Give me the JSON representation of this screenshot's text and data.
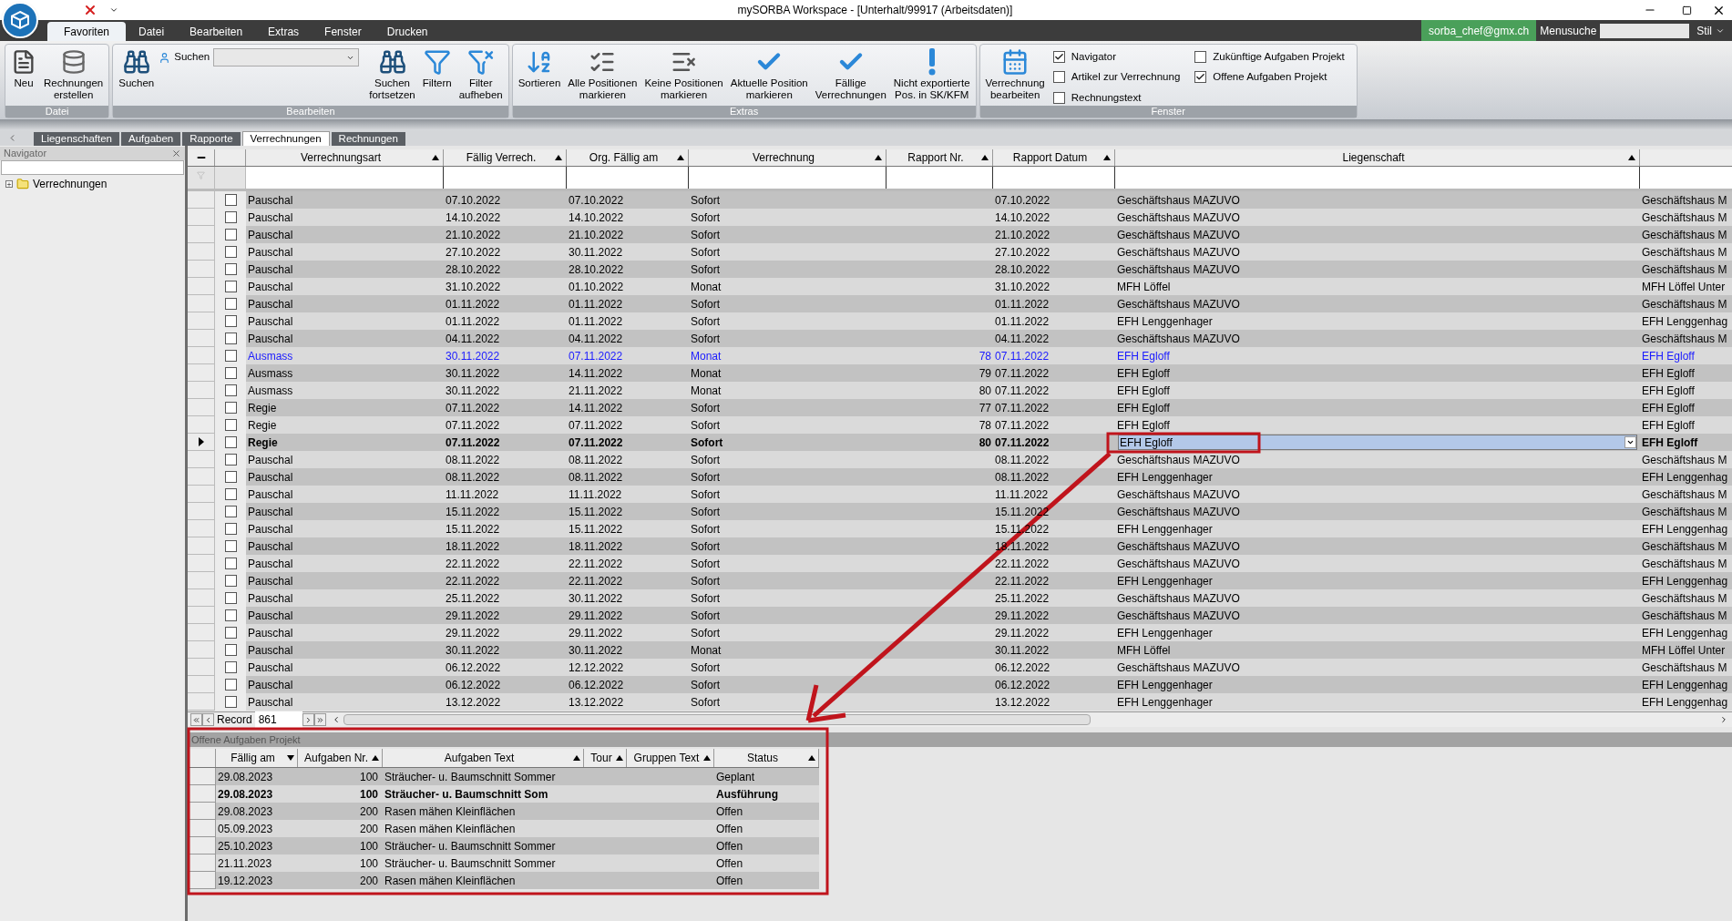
{
  "window": {
    "title": "mySORBA Workspace - [Unterhalt/99917 (Arbeitsdaten)]"
  },
  "menu_tabs": [
    {
      "label": "Favoriten",
      "selected": true
    },
    {
      "label": "Datei",
      "selected": false
    },
    {
      "label": "Bearbeiten",
      "selected": false
    },
    {
      "label": "Extras",
      "selected": false
    },
    {
      "label": "Fenster",
      "selected": false
    },
    {
      "label": "Drucken",
      "selected": false
    }
  ],
  "account": {
    "user": "sorba_chef@gmx.ch",
    "menu_search_label": "Menusuche",
    "style_label": "Stil"
  },
  "ribbon": [
    {
      "title": "Datei",
      "items": [
        {
          "kind": "button",
          "label": "Neu"
        },
        {
          "kind": "button",
          "label": "Rechnungen\nerstellen"
        }
      ]
    },
    {
      "title": "Bearbeiten",
      "items": [
        {
          "kind": "button",
          "label": "Suchen"
        },
        {
          "kind": "search",
          "label": "Suchen"
        },
        {
          "kind": "button",
          "label": "Suchen\nfortsetzen"
        },
        {
          "kind": "button",
          "label": "Filtern"
        },
        {
          "kind": "button",
          "label": "Filter\naufheben"
        }
      ]
    },
    {
      "title": "Extras",
      "items": [
        {
          "kind": "button",
          "label": "Sortieren"
        },
        {
          "kind": "button",
          "label": "Alle Positionen\nmarkieren"
        },
        {
          "kind": "button",
          "label": "Keine Positionen\nmarkieren"
        },
        {
          "kind": "button",
          "label": "Aktuelle Position\nmarkieren"
        },
        {
          "kind": "button",
          "label": "Fällige\nVerrechnungen"
        },
        {
          "kind": "button",
          "label": "Nicht exportierte\nPos. in SK/KFM"
        }
      ]
    },
    {
      "title": "Fenster",
      "items": [
        {
          "kind": "button",
          "label": "Verrechnung\nbearbeiten"
        },
        {
          "kind": "checkboxes",
          "options": [
            {
              "label": "Navigator",
              "checked": true
            },
            {
              "label": "Artikel zur Verrechnung",
              "checked": false
            },
            {
              "label": "Rechnungstext",
              "checked": false
            }
          ]
        },
        {
          "kind": "checkboxes",
          "options": [
            {
              "label": "Zukünftige Aufgaben Projekt",
              "checked": false
            },
            {
              "label": "Offene Aufgaben Projekt",
              "checked": true
            }
          ]
        }
      ]
    }
  ],
  "doc_tabs": [
    {
      "label": "Liegenschaften",
      "selected": false
    },
    {
      "label": "Aufgaben",
      "selected": false
    },
    {
      "label": "Rapporte",
      "selected": false
    },
    {
      "label": "Verrechnungen",
      "selected": true
    },
    {
      "label": "Rechnungen",
      "selected": false
    }
  ],
  "navigator": {
    "title": "Navigator",
    "tree": [
      {
        "label": "Verrechnungen",
        "expanded": false
      }
    ]
  },
  "grid": {
    "columns": [
      {
        "label": "Verrechnungsart",
        "sort_descending": false
      },
      {
        "label": "Fällig Verrech.",
        "sort_descending": false
      },
      {
        "label": "Org. Fällig am",
        "sort_descending": false
      },
      {
        "label": "Verrechnung",
        "sort_descending": false
      },
      {
        "label": "Rapport Nr.",
        "sort_descending": false
      },
      {
        "label": "Rapport Datum",
        "sort_descending": false
      },
      {
        "label": "Liegenschaft",
        "sort_descending": false
      }
    ],
    "rows": [
      {
        "art": "Pauschal",
        "faellig": "07.10.2022",
        "org": "07.10.2022",
        "verrechnung": "Sofort",
        "datum": "07.10.2022",
        "liegenschaft": "Geschäftshaus MAZUVO",
        "column_9": "Geschäftshaus M",
        "checked": false,
        "selected": false,
        "highlighted": false
      },
      {
        "art": "Pauschal",
        "faellig": "14.10.2022",
        "org": "14.10.2022",
        "verrechnung": "Sofort",
        "datum": "14.10.2022",
        "liegenschaft": "Geschäftshaus MAZUVO",
        "column_9": "Geschäftshaus M",
        "checked": false,
        "selected": false,
        "highlighted": false
      },
      {
        "art": "Pauschal",
        "faellig": "21.10.2022",
        "org": "21.10.2022",
        "verrechnung": "Sofort",
        "datum": "21.10.2022",
        "liegenschaft": "Geschäftshaus MAZUVO",
        "column_9": "Geschäftshaus M",
        "checked": false,
        "selected": false,
        "highlighted": false
      },
      {
        "art": "Pauschal",
        "faellig": "27.10.2022",
        "org": "30.11.2022",
        "verrechnung": "Sofort",
        "datum": "27.10.2022",
        "liegenschaft": "Geschäftshaus MAZUVO",
        "column_9": "Geschäftshaus M",
        "checked": false,
        "selected": false,
        "highlighted": false
      },
      {
        "art": "Pauschal",
        "faellig": "28.10.2022",
        "org": "28.10.2022",
        "verrechnung": "Sofort",
        "datum": "28.10.2022",
        "liegenschaft": "Geschäftshaus MAZUVO",
        "column_9": "Geschäftshaus M",
        "checked": false,
        "selected": false,
        "highlighted": false
      },
      {
        "art": "Pauschal",
        "faellig": "31.10.2022",
        "org": "01.10.2022",
        "verrechnung": "Monat",
        "datum": "31.10.2022",
        "liegenschaft": "MFH Löffel",
        "column_9": "MFH Löffel Unter",
        "checked": false,
        "selected": false,
        "highlighted": false
      },
      {
        "art": "Pauschal",
        "faellig": "01.11.2022",
        "org": "01.11.2022",
        "verrechnung": "Sofort",
        "datum": "01.11.2022",
        "liegenschaft": "Geschäftshaus MAZUVO",
        "column_9": "Geschäftshaus M",
        "checked": false,
        "selected": false,
        "highlighted": false
      },
      {
        "art": "Pauschal",
        "faellig": "01.11.2022",
        "org": "01.11.2022",
        "verrechnung": "Sofort",
        "datum": "01.11.2022",
        "liegenschaft": "EFH Lenggenhager",
        "column_9": "EFH Lenggenhag",
        "checked": false,
        "selected": false,
        "highlighted": false
      },
      {
        "art": "Pauschal",
        "faellig": "04.11.2022",
        "org": "04.11.2022",
        "verrechnung": "Sofort",
        "datum": "04.11.2022",
        "liegenschaft": "Geschäftshaus MAZUVO",
        "column_9": "Geschäftshaus M",
        "checked": false,
        "selected": false,
        "highlighted": false
      },
      {
        "art": "Ausmass",
        "faellig": "30.11.2022",
        "org": "07.11.2022",
        "verrechnung": "Monat",
        "nr": "78",
        "datum": "07.11.2022",
        "liegenschaft": "EFH Egloff",
        "column_9": "EFH Egloff",
        "checked": false,
        "selected": false,
        "highlighted": true
      },
      {
        "art": "Ausmass",
        "faellig": "30.11.2022",
        "org": "14.11.2022",
        "verrechnung": "Monat",
        "nr": "79",
        "datum": "07.11.2022",
        "liegenschaft": "EFH Egloff",
        "column_9": "EFH Egloff",
        "checked": false,
        "selected": false,
        "highlighted": false
      },
      {
        "art": "Ausmass",
        "faellig": "30.11.2022",
        "org": "21.11.2022",
        "verrechnung": "Monat",
        "nr": "80",
        "datum": "07.11.2022",
        "liegenschaft": "EFH Egloff",
        "column_9": "EFH Egloff",
        "checked": false,
        "selected": false,
        "highlighted": false
      },
      {
        "art": "Regie",
        "faellig": "07.11.2022",
        "org": "14.11.2022",
        "verrechnung": "Sofort",
        "nr": "77",
        "datum": "07.11.2022",
        "liegenschaft": "EFH Egloff",
        "column_9": "EFH Egloff",
        "checked": false,
        "selected": false,
        "highlighted": false
      },
      {
        "art": "Regie",
        "faellig": "07.11.2022",
        "org": "07.11.2022",
        "verrechnung": "Sofort",
        "nr": "78",
        "datum": "07.11.2022",
        "liegenschaft": "EFH Egloff",
        "column_9": "EFH Egloff",
        "checked": false,
        "selected": false,
        "highlighted": false
      },
      {
        "art": "Regie",
        "faellig": "07.11.2022",
        "org": "07.11.2022",
        "verrechnung": "Sofort",
        "nr": "80",
        "datum": "07.11.2022",
        "liegenschaft": "EFH Egloff",
        "column_9": "EFH Egloff",
        "checked": false,
        "selected": true,
        "highlighted": false
      },
      {
        "art": "Pauschal",
        "faellig": "08.11.2022",
        "org": "08.11.2022",
        "verrechnung": "Sofort",
        "datum": "08.11.2022",
        "liegenschaft": "Geschäftshaus MAZUVO",
        "column_9": "Geschäftshaus M",
        "checked": false,
        "selected": false,
        "highlighted": false
      },
      {
        "art": "Pauschal",
        "faellig": "08.11.2022",
        "org": "08.11.2022",
        "verrechnung": "Sofort",
        "datum": "08.11.2022",
        "liegenschaft": "EFH Lenggenhager",
        "column_9": "EFH Lenggenhag",
        "checked": false,
        "selected": false,
        "highlighted": false
      },
      {
        "art": "Pauschal",
        "faellig": "11.11.2022",
        "org": "11.11.2022",
        "verrechnung": "Sofort",
        "datum": "11.11.2022",
        "liegenschaft": "Geschäftshaus MAZUVO",
        "column_9": "Geschäftshaus M",
        "checked": false,
        "selected": false,
        "highlighted": false
      },
      {
        "art": "Pauschal",
        "faellig": "15.11.2022",
        "org": "15.11.2022",
        "verrechnung": "Sofort",
        "datum": "15.11.2022",
        "liegenschaft": "Geschäftshaus MAZUVO",
        "column_9": "Geschäftshaus M",
        "checked": false,
        "selected": false,
        "highlighted": false
      },
      {
        "art": "Pauschal",
        "faellig": "15.11.2022",
        "org": "15.11.2022",
        "verrechnung": "Sofort",
        "datum": "15.11.2022",
        "liegenschaft": "EFH Lenggenhager",
        "column_9": "EFH Lenggenhag",
        "checked": false,
        "selected": false,
        "highlighted": false
      },
      {
        "art": "Pauschal",
        "faellig": "18.11.2022",
        "org": "18.11.2022",
        "verrechnung": "Sofort",
        "datum": "18.11.2022",
        "liegenschaft": "Geschäftshaus MAZUVO",
        "column_9": "Geschäftshaus M",
        "checked": false,
        "selected": false,
        "highlighted": false
      },
      {
        "art": "Pauschal",
        "faellig": "22.11.2022",
        "org": "22.11.2022",
        "verrechnung": "Sofort",
        "datum": "22.11.2022",
        "liegenschaft": "Geschäftshaus MAZUVO",
        "column_9": "Geschäftshaus M",
        "checked": false,
        "selected": false,
        "highlighted": false
      },
      {
        "art": "Pauschal",
        "faellig": "22.11.2022",
        "org": "22.11.2022",
        "verrechnung": "Sofort",
        "datum": "22.11.2022",
        "liegenschaft": "EFH Lenggenhager",
        "column_9": "EFH Lenggenhag",
        "checked": false,
        "selected": false,
        "highlighted": false
      },
      {
        "art": "Pauschal",
        "faellig": "25.11.2022",
        "org": "30.11.2022",
        "verrechnung": "Sofort",
        "datum": "25.11.2022",
        "liegenschaft": "Geschäftshaus MAZUVO",
        "column_9": "Geschäftshaus M",
        "checked": false,
        "selected": false,
        "highlighted": false
      },
      {
        "art": "Pauschal",
        "faellig": "29.11.2022",
        "org": "29.11.2022",
        "verrechnung": "Sofort",
        "datum": "29.11.2022",
        "liegenschaft": "Geschäftshaus MAZUVO",
        "column_9": "Geschäftshaus M",
        "checked": false,
        "selected": false,
        "highlighted": false
      },
      {
        "art": "Pauschal",
        "faellig": "29.11.2022",
        "org": "29.11.2022",
        "verrechnung": "Sofort",
        "datum": "29.11.2022",
        "liegenschaft": "EFH Lenggenhager",
        "column_9": "EFH Lenggenhag",
        "checked": false,
        "selected": false,
        "highlighted": false
      },
      {
        "art": "Pauschal",
        "faellig": "30.11.2022",
        "org": "30.11.2022",
        "verrechnung": "Monat",
        "datum": "30.11.2022",
        "liegenschaft": "MFH Löffel",
        "column_9": "MFH Löffel Unter",
        "checked": false,
        "selected": false,
        "highlighted": false
      },
      {
        "art": "Pauschal",
        "faellig": "06.12.2022",
        "org": "12.12.2022",
        "verrechnung": "Sofort",
        "datum": "06.12.2022",
        "liegenschaft": "Geschäftshaus MAZUVO",
        "column_9": "Geschäftshaus M",
        "checked": false,
        "selected": false,
        "highlighted": false
      },
      {
        "art": "Pauschal",
        "faellig": "06.12.2022",
        "org": "06.12.2022",
        "verrechnung": "Sofort",
        "datum": "06.12.2022",
        "liegenschaft": "EFH Lenggenhager",
        "column_9": "EFH Lenggenhag",
        "checked": false,
        "selected": false,
        "highlighted": false
      },
      {
        "art": "Pauschal",
        "faellig": "13.12.2022",
        "org": "13.12.2022",
        "verrechnung": "Sofort",
        "datum": "13.12.2022",
        "liegenschaft": "EFH Lenggenhager",
        "column_9": "EFH Lenggenhag",
        "checked": false,
        "selected": false,
        "highlighted": false
      }
    ]
  },
  "record_bar": {
    "label": "Record",
    "value": "861"
  },
  "tasks": {
    "title": "Offene Aufgaben Projekt",
    "columns": [
      {
        "label": "Fällig am",
        "sort_descending": true
      },
      {
        "label": "Aufgaben Nr.",
        "sort_descending": false
      },
      {
        "label": "Aufgaben Text",
        "sort_descending": false
      },
      {
        "label": "Tour",
        "sort_descending": false
      },
      {
        "label": "Gruppen Text",
        "sort_descending": false
      },
      {
        "label": "Status",
        "sort_descending": false
      }
    ],
    "rows": [
      {
        "faellig": "29.08.2023",
        "nr": "100",
        "text": "Sträucher- u. Baumschnitt Sommer",
        "status": "Geplant",
        "selected": false
      },
      {
        "faellig": "29.08.2023",
        "nr": "100",
        "text": "Sträucher- u. Baumschnitt Som",
        "status": "Ausführung",
        "selected": true
      },
      {
        "faellig": "29.08.2023",
        "nr": "200",
        "text": "Rasen mähen Kleinflächen",
        "status": "Offen",
        "selected": false
      },
      {
        "faellig": "05.09.2023",
        "nr": "200",
        "text": "Rasen mähen Kleinflächen",
        "status": "Offen",
        "selected": false
      },
      {
        "faellig": "25.10.2023",
        "nr": "100",
        "text": "Sträucher- u. Baumschnitt Sommer",
        "status": "Offen",
        "selected": false
      },
      {
        "faellig": "21.11.2023",
        "nr": "100",
        "text": "Sträucher- u. Baumschnitt Sommer",
        "status": "Offen",
        "selected": false
      },
      {
        "faellig": "19.12.2023",
        "nr": "200",
        "text": "Rasen mähen Kleinflächen",
        "status": "Offen",
        "selected": false
      }
    ]
  }
}
